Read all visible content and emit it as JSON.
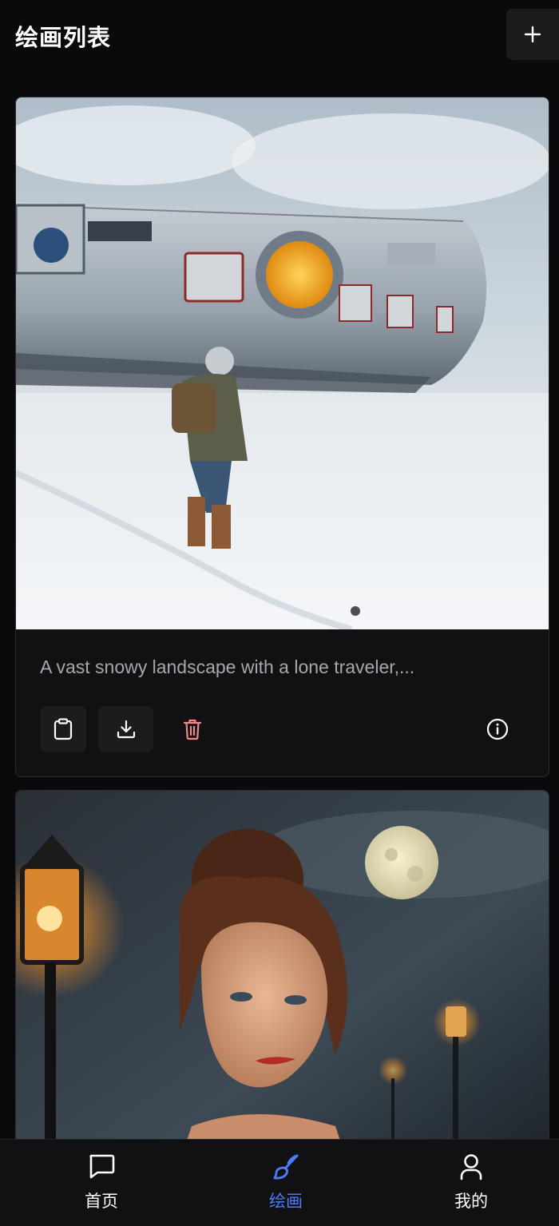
{
  "header": {
    "title": "绘画列表",
    "add_icon": "plus-icon"
  },
  "drawings": [
    {
      "image": "snowy-spaceship-traveler",
      "prompt": "A vast snowy landscape with a lone traveler,...",
      "actions": [
        "clipboard-icon",
        "download-icon",
        "trash-icon",
        "info-icon"
      ]
    },
    {
      "image": "woman-moon-lamps-portrait"
    }
  ],
  "tabbar": {
    "items": [
      {
        "label": "首页",
        "icon": "chat-bubble-icon",
        "active": false
      },
      {
        "label": "绘画",
        "icon": "brush-icon",
        "active": true
      },
      {
        "label": "我的",
        "icon": "user-icon",
        "active": false
      }
    ]
  },
  "colors": {
    "background": "#0a0a0c",
    "card": "#111113",
    "accent": "#4d7cff",
    "danger": "#f08a8a"
  }
}
